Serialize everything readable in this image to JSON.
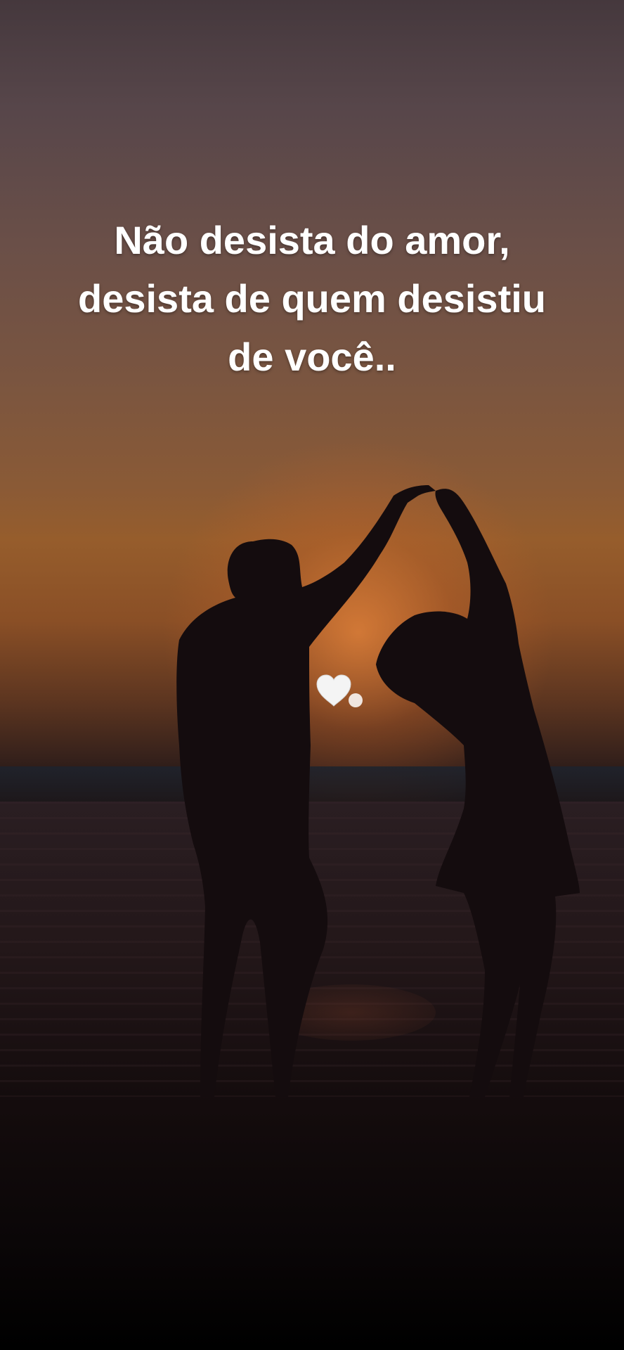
{
  "quote": {
    "line1": "Não desista do amor,",
    "line2": "desista de quem desistiu",
    "line3": "de você.."
  },
  "heart_icon": "white-heart-emoji",
  "colors": {
    "text": "#ffffff",
    "sky_top": "#45383d",
    "sunset": "#965d2c",
    "ground": "#000000"
  }
}
